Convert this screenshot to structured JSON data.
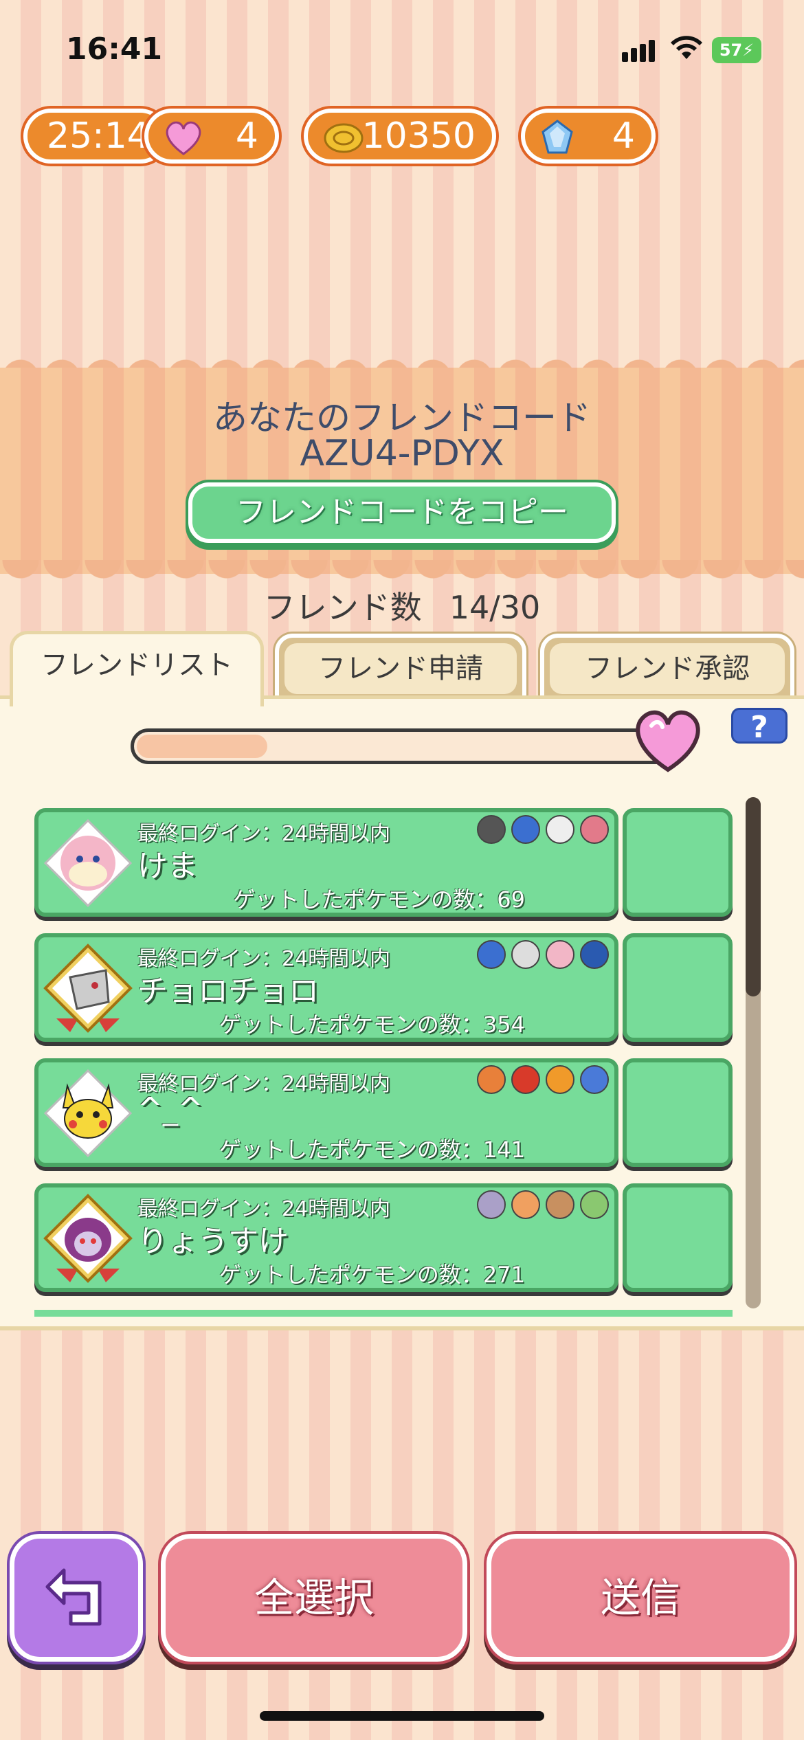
{
  "status_bar": {
    "time": "16:41",
    "battery": "57"
  },
  "resources": {
    "timer": "25:14",
    "hearts": "4",
    "coins": "10350",
    "jewels": "4"
  },
  "friend_code": {
    "title": "あなたのフレンドコード",
    "code": "AZU4-PDYX",
    "copy_label": "フレンドコードをコピー"
  },
  "friend_count": {
    "label": "フレンド数",
    "value": "14/30"
  },
  "tabs": [
    {
      "label": "フレンドリスト"
    },
    {
      "label": "フレンド申請"
    },
    {
      "label": "フレンド承認"
    }
  ],
  "help_label": "?",
  "heart_slider": {
    "fill_fraction": 0.24
  },
  "friends": [
    {
      "login": "最終ログイン：24時間以内",
      "name": "けま",
      "caught": "ゲットしたポケモンの数：69",
      "avatar": "audino-icon",
      "icon_colors": [
        "#555",
        "#3b6fd0",
        "#eee",
        "#e27a8a"
      ]
    },
    {
      "login": "最終ログイン：24時間以内",
      "name": "チョロチョロ",
      "caught": "ゲットしたポケモンの数：354",
      "avatar": "silvally-icon",
      "icon_colors": [
        "#3b6fd0",
        "#ddd",
        "#f2b6c6",
        "#2a5ab0"
      ]
    },
    {
      "login": "最終ログイン：24時間以内",
      "name": "^_^",
      "caught": "ゲットしたポケモンの数：141",
      "avatar": "pikachu-icon",
      "icon_colors": [
        "#e8803a",
        "#d83a2a",
        "#f09a2a",
        "#4a7ad8"
      ]
    },
    {
      "login": "最終ログイン：24時間以内",
      "name": "りょうすけ",
      "caught": "ゲットしたポケモンの数：271",
      "avatar": "hoopa-icon",
      "icon_colors": [
        "#aaa0c8",
        "#f0a060",
        "#c89060",
        "#8ac870"
      ]
    }
  ],
  "buttons": {
    "back_icon": "back-arrow-icon",
    "select_all": "全選択",
    "send": "送信"
  }
}
